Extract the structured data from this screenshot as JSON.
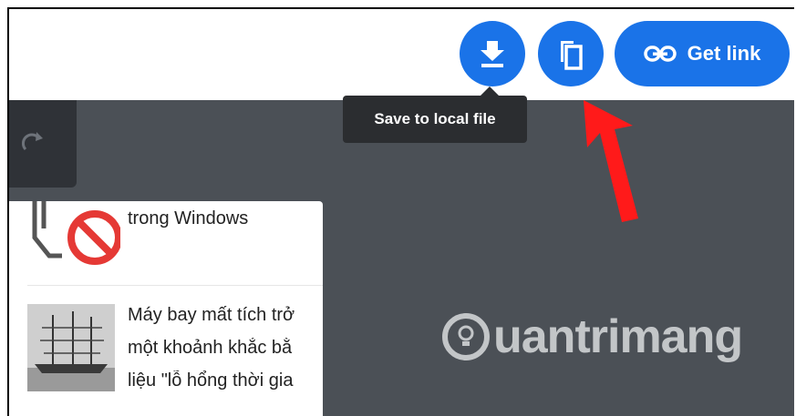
{
  "toolbar": {
    "download_icon": "download-icon",
    "copy_icon": "copy-icon",
    "get_link_label": "Get link",
    "get_link_icon": "link-icon",
    "accent": "#1a73e8"
  },
  "tooltip": {
    "text": "Save to local file"
  },
  "side_toolbar": {
    "icon": "redo-icon"
  },
  "article_list": {
    "items": [
      {
        "lines": [
          "trong Windows"
        ],
        "thumb_icon": "blocked-icon"
      },
      {
        "lines": [
          "Máy bay mất tích trở",
          "một khoảnh khắc bằ",
          "liệu \"lỗ hổng thời gia"
        ],
        "thumb_icon": "ship-image"
      }
    ]
  },
  "watermark": {
    "text": "uantrimang"
  }
}
